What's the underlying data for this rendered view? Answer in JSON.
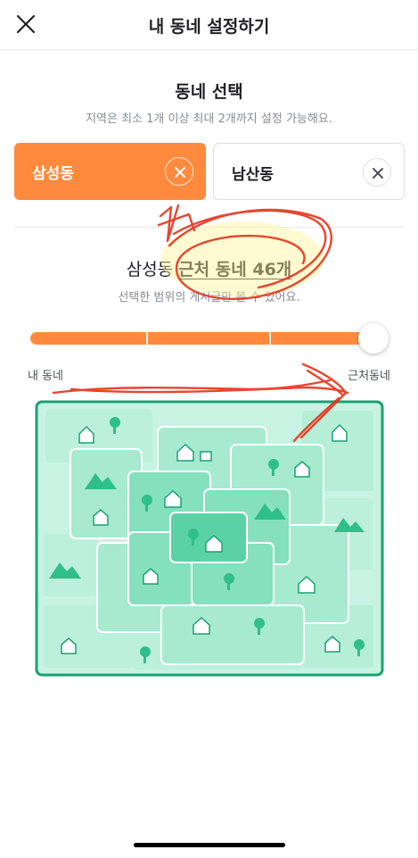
{
  "header": {
    "title": "내 동네 설정하기",
    "close_icon": "close-icon"
  },
  "select_section": {
    "title": "동네 선택",
    "subtitle": "지역은 최소 1개 이상 최대 2개까지 설정 가능해요."
  },
  "neighborhoods": [
    {
      "label": "삼성동",
      "selected": true
    },
    {
      "label": "남산동",
      "selected": false
    }
  ],
  "range": {
    "prefix": "삼성동",
    "count_text": "근처 동네 46개",
    "subtitle": "선택한 범위의 게시글만 볼 수 있어요.",
    "slider_level": 1.0,
    "slider_steps": 4,
    "label_min": "내 동네",
    "label_max": "근처동네"
  },
  "colors": {
    "accent": "#ff8a3d",
    "map_border": "#1aa174",
    "scribble": "#e5321a"
  }
}
